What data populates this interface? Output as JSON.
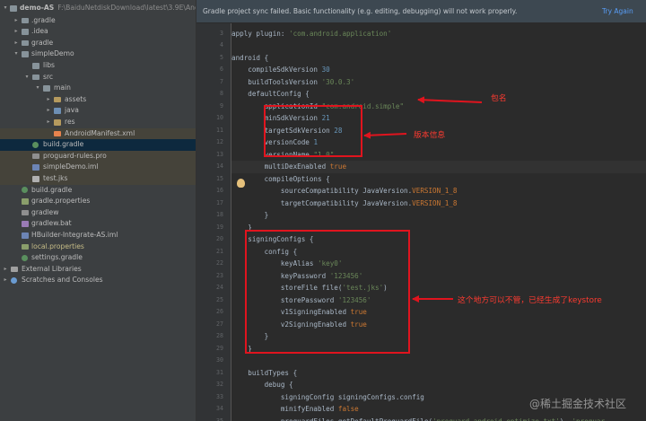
{
  "tree": {
    "root_name": "demo-AS",
    "root_path": "F:\\BaiduNetdiskDownload\\latest\\3.9E\\Andr",
    "items": [
      {
        "label": "gradle",
        "prefix": "."
      },
      {
        "label": ".idea"
      },
      {
        "label": "gradle"
      },
      {
        "label": "simpleDemo"
      },
      {
        "label": "libs"
      },
      {
        "label": "src"
      },
      {
        "label": "main"
      },
      {
        "label": "assets"
      },
      {
        "label": "java"
      },
      {
        "label": "res"
      },
      {
        "label": "AndroidManifest.xml"
      },
      {
        "label": "build.gradle"
      },
      {
        "label": "proguard-rules.pro"
      },
      {
        "label": "simpleDemo.iml"
      },
      {
        "label": "test.jks"
      },
      {
        "label": "build.gradle"
      },
      {
        "label": "gradle.properties"
      },
      {
        "label": "gradlew"
      },
      {
        "label": "gradlew.bat"
      },
      {
        "label": "HBuilder-Integrate-AS.iml"
      },
      {
        "label": "local.properties"
      },
      {
        "label": "settings.gradle"
      },
      {
        "label": "External Libraries"
      },
      {
        "label": "Scratches and Consoles"
      }
    ]
  },
  "banner": {
    "message": "Gradle project sync failed. Basic functionality (e.g. editing, debugging) will not work properly.",
    "action": "Try Again"
  },
  "editor": {
    "line_numbers": [
      "3",
      "4",
      "5",
      "6",
      "7",
      "8",
      "9",
      "10",
      "11",
      "12",
      "13",
      "14",
      "15",
      "16",
      "17",
      "18",
      "19",
      "20",
      "21",
      "22",
      "23",
      "24",
      "25",
      "26",
      "27",
      "28",
      "29",
      "30",
      "31",
      "32",
      "33",
      "34",
      "35"
    ],
    "lines": [
      [
        "apply plugin: ",
        "'com.android.application'"
      ],
      [
        ""
      ],
      [
        "android {"
      ],
      [
        "    compileSdkVersion ",
        "30"
      ],
      [
        "    buildToolsVersion ",
        "'30.0.3'"
      ],
      [
        "    defaultConfig {"
      ],
      [
        "        applicationId ",
        "\"com.android.simple\""
      ],
      [
        "        minSdkVersion ",
        "21"
      ],
      [
        "        targetSdkVersion ",
        "28"
      ],
      [
        "        versionCode ",
        "1"
      ],
      [
        "        versionName ",
        "\"1.0\""
      ],
      [
        "        multiDexEnabled ",
        "true"
      ],
      [
        "        compileOptions {"
      ],
      [
        "            sourceCompatibility JavaVersion.",
        "VERSION_1_8"
      ],
      [
        "            targetCompatibility JavaVersion.",
        "VERSION_1_8"
      ],
      [
        "        }"
      ],
      [
        "    }"
      ],
      [
        "    signingConfigs {"
      ],
      [
        "        config {"
      ],
      [
        "            keyAlias ",
        "'key0'"
      ],
      [
        "            keyPassword ",
        "'123456'"
      ],
      [
        "            storeFile file(",
        "'test.jks'",
        ")"
      ],
      [
        "            storePassword ",
        "'123456'"
      ],
      [
        "            v1SigningEnabled ",
        "true"
      ],
      [
        "            v2SigningEnabled ",
        "true"
      ],
      [
        "        }"
      ],
      [
        "    }"
      ],
      [
        ""
      ],
      [
        "    buildTypes {"
      ],
      [
        "        debug {"
      ],
      [
        "            signingConfig signingConfigs.",
        "config"
      ],
      [
        "            minifyEnabled ",
        "false"
      ],
      [
        "            proguardFiles getDefaultProguardFile(",
        "'proguard-android-optimize.txt'",
        "), ",
        "'proguar"
      ]
    ]
  },
  "annotations": {
    "package_name": "包名",
    "version_info": "版本信息",
    "keystore_note": "这个地方可以不管，已经生成了keystore"
  },
  "watermark": "@稀土掘金技术社区",
  "colors": {
    "annotation": "#e0141e",
    "string": "#6a8759",
    "number": "#6897bb",
    "keyword": "#cc7832",
    "link": "#589df6"
  }
}
